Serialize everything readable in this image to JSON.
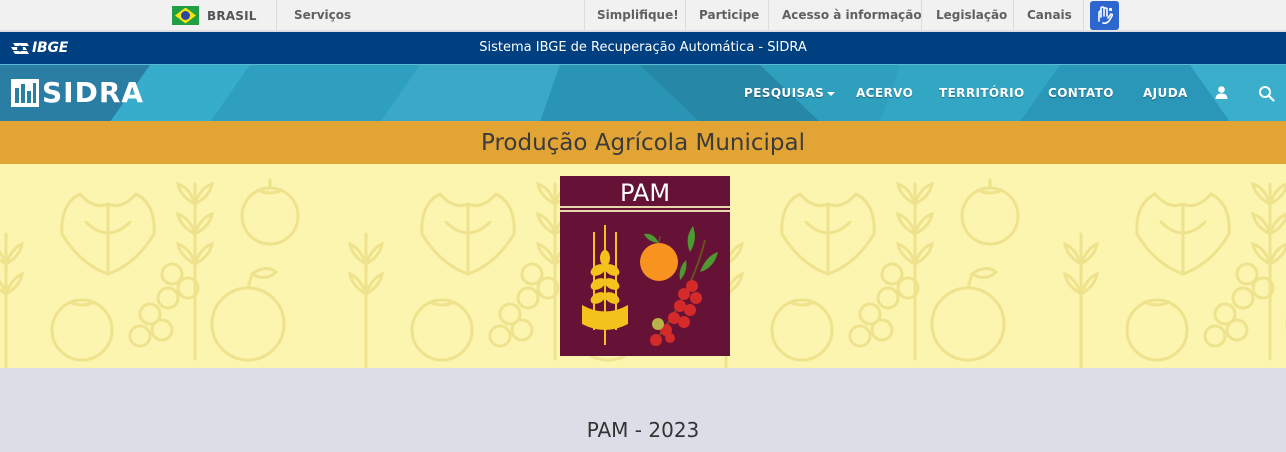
{
  "gov_bar": {
    "country": "BRASIL",
    "services": "Serviços",
    "links": [
      "Simplifique!",
      "Participe",
      "Acesso à informação",
      "Legislação",
      "Canais"
    ],
    "libras_icon": "hands-sign-language-icon"
  },
  "ibge_bar": {
    "logo_text": "IBGE",
    "title": "Sistema IBGE de Recuperação Automática - SIDRA"
  },
  "sidra_nav": {
    "logo_text": "SIDRA",
    "items": [
      "PESQUISAS",
      "ACERVO",
      "TERRITÓRIO",
      "CONTATO",
      "AJUDA"
    ],
    "user_icon": "user-icon",
    "search_icon": "search-icon"
  },
  "page": {
    "title": "Produção Agrícola Municipal",
    "badge_title": "PAM",
    "edition": "PAM - 2023"
  },
  "colors": {
    "gov_bar": "#f1f1f1",
    "ibge_bar": "#003f80",
    "sidra_bar": "#2a9bbb",
    "title_band": "#e3a436",
    "banner_bg": "#fbf5b0",
    "badge_bg": "#651236"
  }
}
